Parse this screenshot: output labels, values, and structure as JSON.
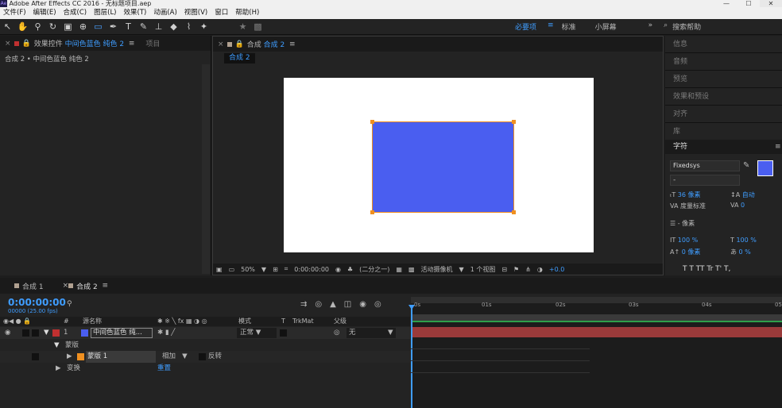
{
  "window": {
    "title": "Adobe After Effects CC 2016 - 无标题项目.aep",
    "logo": "Ae"
  },
  "menu": [
    "文件(F)",
    "编辑(E)",
    "合成(C)",
    "图层(L)",
    "效果(T)",
    "动画(A)",
    "视图(V)",
    "窗口",
    "帮助(H)"
  ],
  "workspaces": {
    "essentials": "必要项",
    "standard": "标准",
    "small": "小屏幕",
    "more": "»",
    "search": "搜索帮助"
  },
  "left_panel": {
    "tab": "效果控件",
    "tab_layer": "中间色蓝色 纯色 2",
    "tab_project": "项目",
    "breadcrumb": "合成 2 • 中间色蓝色 纯色 2"
  },
  "comp_panel": {
    "tab": "合成",
    "tab_name": "合成 2",
    "subtab": "合成 2",
    "solid_color": "#4a5ef0",
    "footer": {
      "zoom": "50%",
      "time": "0:00:00:00",
      "resolution": "(二分之一)",
      "camera": "活动摄像机",
      "views": "1 个视图",
      "exposure": "+0.0"
    }
  },
  "right_panel": {
    "items": [
      "信息",
      "音频",
      "预览",
      "效果和预设",
      "对齐",
      "库"
    ],
    "character": {
      "title": "字符",
      "font": "Fixedsys",
      "style": "-",
      "size": "36 像素",
      "leading": "自动",
      "kerning": "度量标准",
      "tracking": "0",
      "stroke": "- 像素",
      "vscale": "100 %",
      "hscale": "100 %",
      "baseline": "0 像素",
      "tsume": "0 %",
      "styles": "T T TT Tr T' T,"
    }
  },
  "timeline": {
    "tab1": "合成 1",
    "tab2": "合成 2",
    "timecode": "0:00:00:00",
    "fps": "00000 (25.00 fps)",
    "columns": {
      "num": "#",
      "source": "源名称",
      "mode": "模式",
      "t": "T",
      "trkmat": "TrkMat",
      "parent": "父级"
    },
    "layer": {
      "num": "1",
      "name": "中间色蓝色 纯...",
      "mode": "正常",
      "parent": "无"
    },
    "masks": "蒙版",
    "mask1": "蒙版 1",
    "mask_mode": "相加",
    "invert": "反转",
    "transform": "变换",
    "reset": "重置",
    "ticks": [
      "0s",
      "01s",
      "02s",
      "03s",
      "04s",
      "05"
    ]
  }
}
